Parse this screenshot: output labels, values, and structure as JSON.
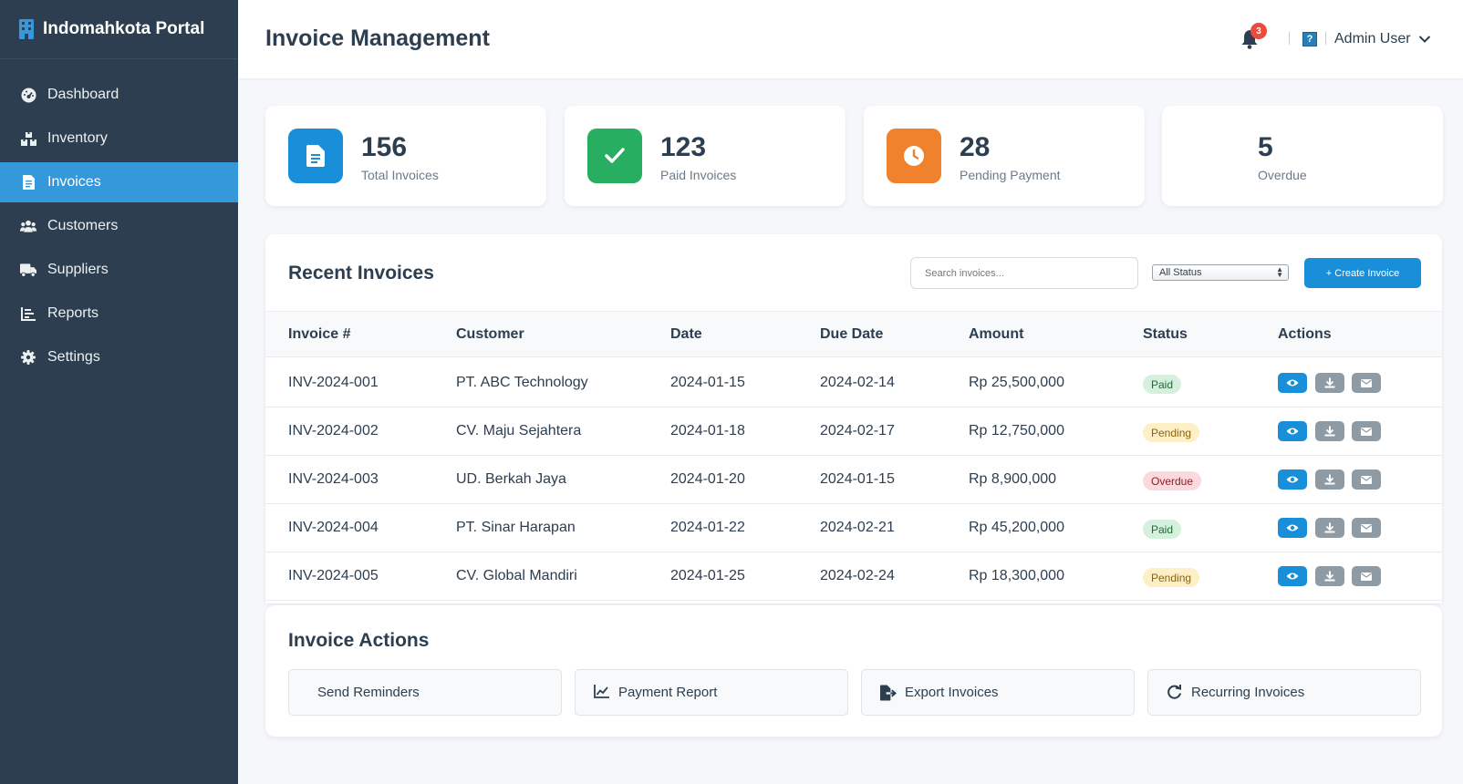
{
  "brand": {
    "title": "Indomahkota Portal"
  },
  "sidebar": {
    "items": [
      {
        "label": "Dashboard",
        "icon": "dashboard-icon",
        "active": false
      },
      {
        "label": "Inventory",
        "icon": "boxes-icon",
        "active": false
      },
      {
        "label": "Invoices",
        "icon": "file-invoice-icon",
        "active": true
      },
      {
        "label": "Customers",
        "icon": "users-icon",
        "active": false
      },
      {
        "label": "Suppliers",
        "icon": "truck-icon",
        "active": false
      },
      {
        "label": "Reports",
        "icon": "chart-icon",
        "active": false
      },
      {
        "label": "Settings",
        "icon": "gear-icon",
        "active": false
      }
    ]
  },
  "header": {
    "title": "Invoice Management",
    "notification_count": "3",
    "avatar_glyph": "?",
    "user_name": "Admin User"
  },
  "stats": [
    {
      "value": "156",
      "label": "Total Invoices",
      "color": "#1a8fd9",
      "icon": "document-icon"
    },
    {
      "value": "123",
      "label": "Paid Invoices",
      "color": "#27ae60",
      "icon": "check-icon"
    },
    {
      "value": "28",
      "label": "Pending Payment",
      "color": "#f0812d",
      "icon": "clock-icon"
    },
    {
      "value": "5",
      "label": "Overdue"
    }
  ],
  "recent": {
    "title": "Recent Invoices",
    "search_placeholder": "Search invoices...",
    "status_filter": "All Status",
    "create_label": "+ Create Invoice",
    "columns": [
      "Invoice #",
      "Customer",
      "Date",
      "Due Date",
      "Amount",
      "Status",
      "Actions"
    ],
    "rows": [
      {
        "id": "INV-2024-001",
        "customer": "PT. ABC Technology",
        "date": "2024-01-15",
        "due": "2024-02-14",
        "amount": "Rp 25,500,000",
        "status": "Paid"
      },
      {
        "id": "INV-2024-002",
        "customer": "CV. Maju Sejahtera",
        "date": "2024-01-18",
        "due": "2024-02-17",
        "amount": "Rp 12,750,000",
        "status": "Pending"
      },
      {
        "id": "INV-2024-003",
        "customer": "UD. Berkah Jaya",
        "date": "2024-01-20",
        "due": "2024-01-15",
        "amount": "Rp 8,900,000",
        "status": "Overdue"
      },
      {
        "id": "INV-2024-004",
        "customer": "PT. Sinar Harapan",
        "date": "2024-01-22",
        "due": "2024-02-21",
        "amount": "Rp 45,200,000",
        "status": "Paid"
      },
      {
        "id": "INV-2024-005",
        "customer": "CV. Global Mandiri",
        "date": "2024-01-25",
        "due": "2024-02-24",
        "amount": "Rp 18,300,000",
        "status": "Pending"
      }
    ]
  },
  "actions": {
    "title": "Invoice Actions",
    "buttons": [
      {
        "label": "Send Reminders"
      },
      {
        "label": "Payment Report",
        "icon": "line-chart-icon"
      },
      {
        "label": "Export Invoices",
        "icon": "export-icon"
      },
      {
        "label": "Recurring Invoices",
        "icon": "refresh-icon"
      }
    ]
  }
}
